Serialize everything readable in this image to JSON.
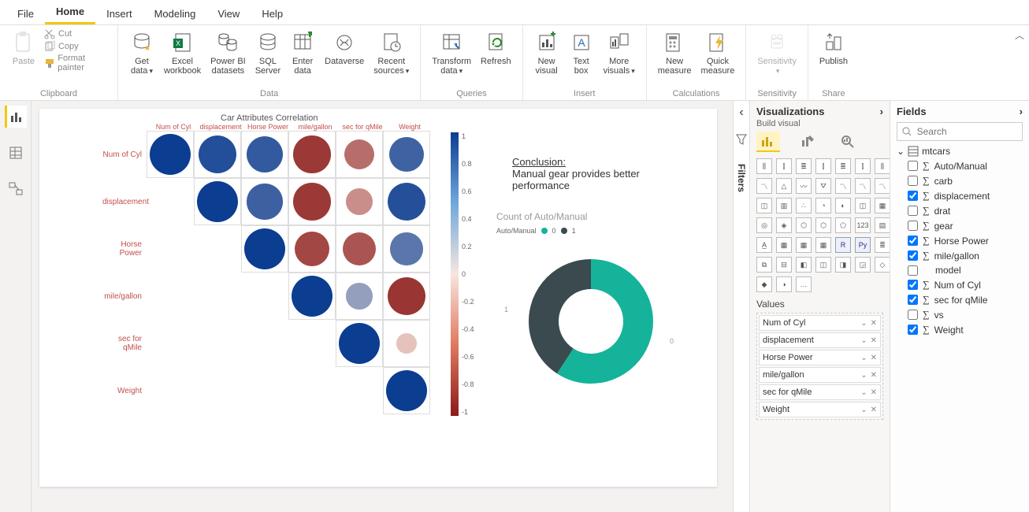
{
  "menu": {
    "items": [
      "File",
      "Home",
      "Insert",
      "Modeling",
      "View",
      "Help"
    ],
    "active": "Home"
  },
  "ribbon": {
    "clipboard": {
      "paste": "Paste",
      "cut": "Cut",
      "copy": "Copy",
      "format_painter": "Format painter",
      "group": "Clipboard"
    },
    "data": {
      "buttons": [
        {
          "l1": "Get",
          "l2": "data",
          "caret": true
        },
        {
          "l1": "Excel",
          "l2": "workbook"
        },
        {
          "l1": "Power BI",
          "l2": "datasets"
        },
        {
          "l1": "SQL",
          "l2": "Server"
        },
        {
          "l1": "Enter",
          "l2": "data"
        },
        {
          "l1": "Dataverse",
          "l2": ""
        },
        {
          "l1": "Recent",
          "l2": "sources",
          "caret": true
        }
      ],
      "group": "Data"
    },
    "queries": {
      "buttons": [
        {
          "l1": "Transform",
          "l2": "data",
          "caret": true
        },
        {
          "l1": "Refresh",
          "l2": ""
        }
      ],
      "group": "Queries"
    },
    "insert": {
      "buttons": [
        {
          "l1": "New",
          "l2": "visual"
        },
        {
          "l1": "Text",
          "l2": "box"
        },
        {
          "l1": "More",
          "l2": "visuals",
          "caret": true
        }
      ],
      "group": "Insert"
    },
    "calc": {
      "buttons": [
        {
          "l1": "New",
          "l2": "measure"
        },
        {
          "l1": "Quick",
          "l2": "measure"
        }
      ],
      "group": "Calculations"
    },
    "sensitivity": {
      "buttons": [
        {
          "l1": "Sensitivity",
          "l2": "",
          "caret": true,
          "disabled": true
        }
      ],
      "group": "Sensitivity"
    },
    "share": {
      "buttons": [
        {
          "l1": "Publish",
          "l2": ""
        }
      ],
      "group": "Share"
    }
  },
  "filters_label": "Filters",
  "viz_pane": {
    "title": "Visualizations",
    "subtitle": "Build visual",
    "values_label": "Values",
    "values": [
      "Num of Cyl",
      "displacement",
      "Horse Power",
      "mile/gallon",
      "sec for qMile",
      "Weight"
    ]
  },
  "fields_pane": {
    "title": "Fields",
    "search_placeholder": "Search",
    "table": "mtcars",
    "fields": [
      {
        "name": "Auto/Manual",
        "sigma": true,
        "checked": false
      },
      {
        "name": "carb",
        "sigma": true,
        "checked": false
      },
      {
        "name": "displacement",
        "sigma": true,
        "checked": true
      },
      {
        "name": "drat",
        "sigma": true,
        "checked": false
      },
      {
        "name": "gear",
        "sigma": true,
        "checked": false
      },
      {
        "name": "Horse Power",
        "sigma": true,
        "checked": true
      },
      {
        "name": "mile/gallon",
        "sigma": true,
        "checked": true
      },
      {
        "name": "model",
        "sigma": false,
        "checked": false
      },
      {
        "name": "Num of Cyl",
        "sigma": true,
        "checked": true
      },
      {
        "name": "sec for qMile",
        "sigma": true,
        "checked": true
      },
      {
        "name": "vs",
        "sigma": true,
        "checked": false
      },
      {
        "name": "Weight",
        "sigma": true,
        "checked": true
      }
    ]
  },
  "canvas": {
    "corr_title": "Car Attributes Correlation",
    "top_labels": [
      "Num of Cyl",
      "displacement",
      "Horse Power",
      "mile/gallon",
      "sec for qMile",
      "Weight"
    ],
    "row_labels": [
      "Num of Cyl",
      "displacement",
      "Horse Power",
      "mile/gallon",
      "sec for qMile",
      "Weight"
    ],
    "colorbar_ticks": [
      "1",
      "0.8",
      "0.6",
      "0.4",
      "0.2",
      "0",
      "-0.2",
      "-0.4",
      "-0.6",
      "-0.8",
      "-1"
    ],
    "conclusion_heading": "Conclusion:",
    "conclusion_body": "Manual gear provides better performance",
    "donut_title": "Count of Auto/Manual",
    "donut_legend_label": "Auto/Manual",
    "donut_legend": [
      "0",
      "1"
    ],
    "axis0": "0",
    "axis1": "1"
  },
  "chart_data": [
    {
      "type": "heatmap",
      "title": "Car Attributes Correlation",
      "x_labels": [
        "Num of Cyl",
        "displacement",
        "Horse Power",
        "mile/gallon",
        "sec for qMile",
        "Weight"
      ],
      "y_labels": [
        "Num of Cyl",
        "displacement",
        "Horse Power",
        "mile/gallon",
        "sec for qMile",
        "Weight"
      ],
      "matrix": [
        [
          1.0,
          0.9,
          0.83,
          -0.85,
          -0.59,
          0.78
        ],
        [
          null,
          1.0,
          0.79,
          -0.85,
          -0.43,
          0.89
        ],
        [
          null,
          null,
          1.0,
          -0.78,
          -0.71,
          0.66
        ],
        [
          null,
          null,
          null,
          1.0,
          0.42,
          -0.87
        ],
        [
          null,
          null,
          null,
          null,
          1.0,
          -0.17
        ],
        [
          null,
          null,
          null,
          null,
          null,
          1.0
        ]
      ],
      "color_scale": {
        "min": -1,
        "max": 1,
        "low": "#8b1a1a",
        "mid": "#f7e6de",
        "high": "#0b3d91"
      }
    },
    {
      "type": "pie",
      "title": "Count of Auto/Manual",
      "series": [
        {
          "name": "Auto/Manual",
          "categories": [
            "0",
            "1"
          ],
          "values": [
            19,
            13
          ]
        }
      ],
      "colors": {
        "0": "#15b39a",
        "1": "#3a4a4f"
      },
      "donut": true
    }
  ]
}
